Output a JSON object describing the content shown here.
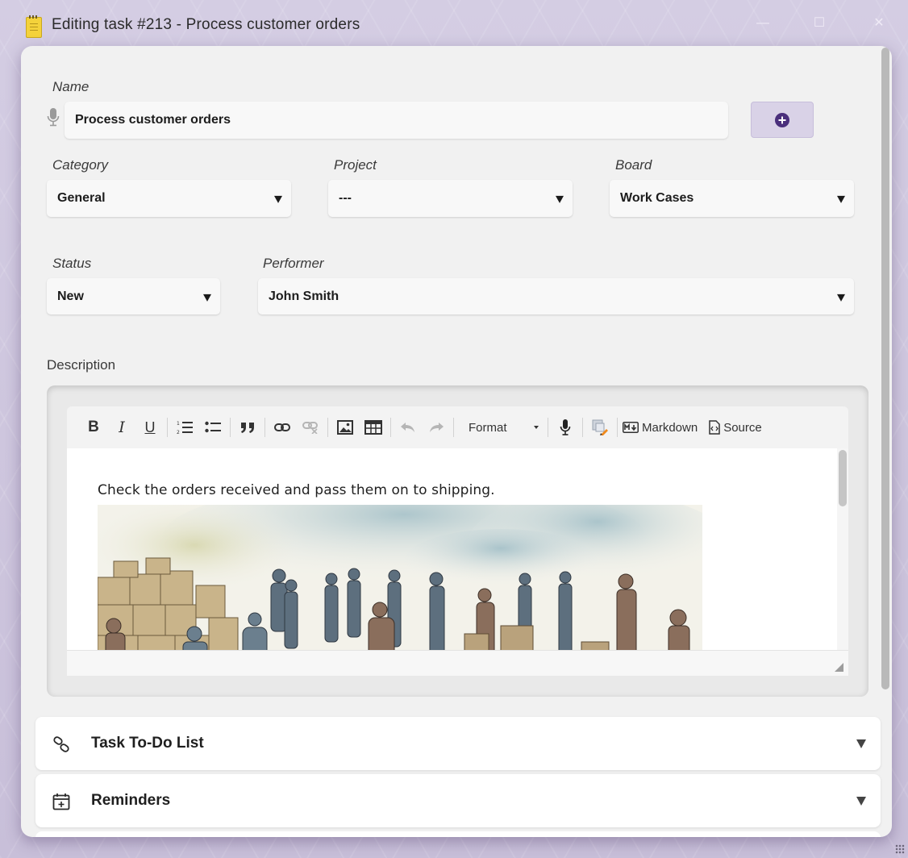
{
  "window": {
    "title": "Editing task #213 - Process customer orders",
    "icon": "notepad-icon"
  },
  "form": {
    "name_label": "Name",
    "name_value": "Process customer orders",
    "add_button_icon": "plus-circle-icon",
    "category_label": "Category",
    "category_value": "General",
    "project_label": "Project",
    "project_value": "---",
    "board_label": "Board",
    "board_value": "Work Cases",
    "status_label": "Status",
    "status_value": "New",
    "performer_label": "Performer",
    "performer_value": "John Smith"
  },
  "description": {
    "label": "Description",
    "toolbar": {
      "bold": "B",
      "italic": "I",
      "underline": "U",
      "format_label": "Format",
      "markdown_label": "Markdown",
      "source_label": "Source"
    },
    "content_text": "Check the orders received and pass them on to shipping."
  },
  "panels": [
    {
      "title": "Task To-Do List",
      "icon": "link-icon"
    },
    {
      "title": "Reminders",
      "icon": "calendar-plus-icon"
    }
  ],
  "colors": {
    "accent": "#4a2f7c",
    "frame": "#c9c1da",
    "dialog_bg": "#f1f1f1"
  }
}
